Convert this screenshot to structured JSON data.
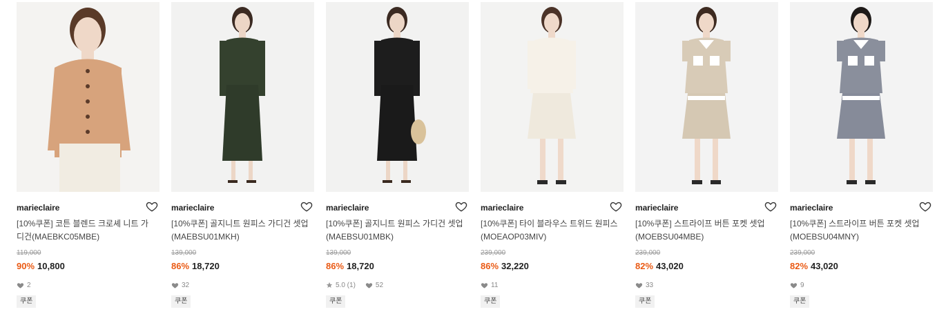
{
  "products": [
    {
      "brand": "marieclaire",
      "name": "[10%쿠폰] 코튼 블렌드 크로셰 니트 가디건(MAEBKC05MBE)",
      "original_price": "119,000",
      "discount": "90%",
      "price": "10,800",
      "rating": "",
      "likes": "2",
      "tag": "쿠폰",
      "colors": {
        "bg": "#f4f3f1",
        "top": "#d7a37c",
        "bottom": "#f1ece2",
        "skin": "#efd8c8",
        "hair": "#5a3a28"
      }
    },
    {
      "brand": "marieclaire",
      "name": "[10%쿠폰] 골지니트 원피스 가디건 셋업(MAEBSU01MKH)",
      "original_price": "139,000",
      "discount": "86%",
      "price": "18,720",
      "rating": "",
      "likes": "32",
      "tag": "쿠폰",
      "colors": {
        "bg": "#f2f2f1",
        "top": "#34412e",
        "bottom": "#2f3b2a",
        "skin": "#ecd6c6",
        "hair": "#3b2a22"
      }
    },
    {
      "brand": "marieclaire",
      "name": "[10%쿠폰] 골지니트 원피스 가디건 셋업(MAEBSU01MBK)",
      "original_price": "139,000",
      "discount": "86%",
      "price": "18,720",
      "rating": "5.0 (1)",
      "likes": "52",
      "tag": "쿠폰",
      "colors": {
        "bg": "#f2f2f1",
        "top": "#1d1d1d",
        "bottom": "#1a1a1a",
        "skin": "#ecd6c6",
        "hair": "#3b2a22"
      }
    },
    {
      "brand": "marieclaire",
      "name": "[10%쿠폰] 타이 블라우스 트위드 원피스(MOEAOP03MIV)",
      "original_price": "239,000",
      "discount": "86%",
      "price": "32,220",
      "rating": "",
      "likes": "11",
      "tag": "쿠폰",
      "colors": {
        "bg": "#f3f3f2",
        "top": "#f6f1e8",
        "bottom": "#efe9dd",
        "skin": "#efd9ca",
        "hair": "#4b3328"
      }
    },
    {
      "brand": "marieclaire",
      "name": "[10%쿠폰] 스트라이프 버튼 포켓 셋업(MOEBSU04MBE)",
      "original_price": "239,000",
      "discount": "82%",
      "price": "43,020",
      "rating": "",
      "likes": "33",
      "tag": "쿠폰",
      "colors": {
        "bg": "#f3f3f3",
        "top": "#d8cbb7",
        "bottom": "#d5c8b3",
        "skin": "#efd8c8",
        "hair": "#3d2a20"
      }
    },
    {
      "brand": "marieclaire",
      "name": "[10%쿠폰] 스트라이프 버튼 포켓 셋업(MOEBSU04MNY)",
      "original_price": "239,000",
      "discount": "82%",
      "price": "43,020",
      "rating": "",
      "likes": "9",
      "tag": "쿠폰",
      "colors": {
        "bg": "#f3f3f3",
        "top": "#8a8f9c",
        "bottom": "#868b99",
        "skin": "#efd8c8",
        "hair": "#1e1a18"
      }
    }
  ],
  "icons": {
    "wish": "heart-outline-icon",
    "like": "heart-filled-icon",
    "rating": "star-icon"
  }
}
